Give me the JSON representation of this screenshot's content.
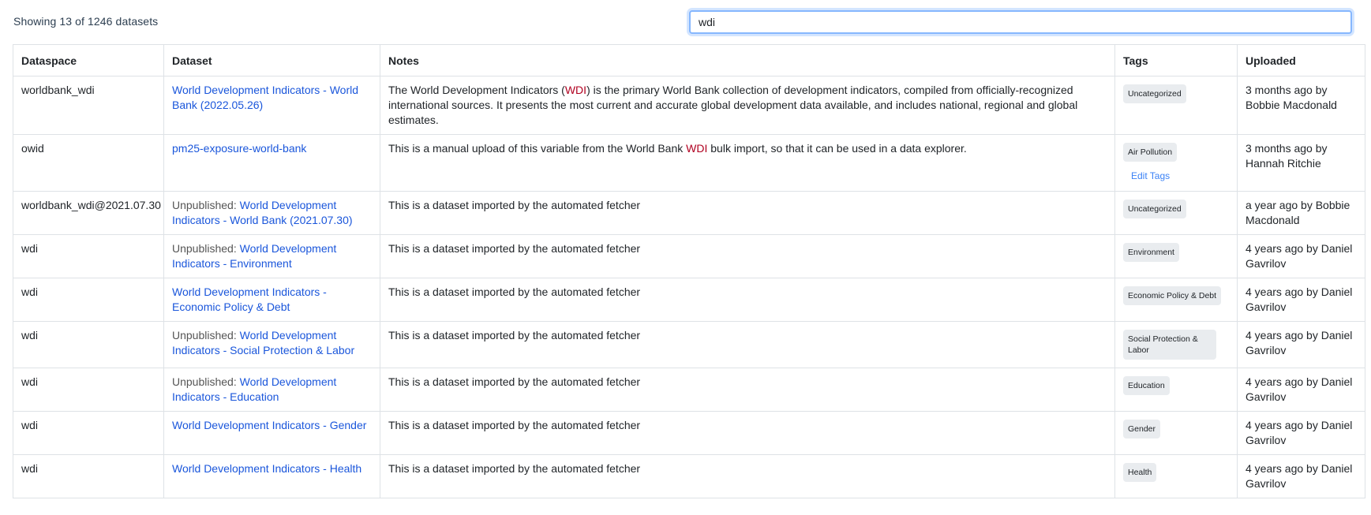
{
  "header": {
    "count_text": "Showing 13 of 1246 datasets",
    "search_value": "wdi"
  },
  "table": {
    "columns": [
      "Dataspace",
      "Dataset",
      "Notes",
      "Tags",
      "Uploaded"
    ],
    "rows": [
      {
        "dataspace": "worldbank_wdi",
        "unpublished": "",
        "dataset": "World Development Indicators - World Bank (2022.05.26)",
        "notes_parts": [
          "The World Development Indicators (",
          "WDI",
          ") is the primary World Bank collection of development indicators, compiled from officially-recognized international sources. It presents the most current and accurate global development data available, and includes national, regional and global estimates."
        ],
        "tag": "Uncategorized",
        "uploaded": "3 months ago by Bobbie Macdonald"
      },
      {
        "dataspace": "owid",
        "unpublished": "",
        "dataset": "pm25-exposure-world-bank",
        "notes_parts": [
          "This is a manual upload of this variable from the World Bank ",
          "WDI",
          " bulk import, so that it can be used in a data explorer."
        ],
        "tag": "Air Pollution",
        "edit_tags": "Edit Tags",
        "uploaded": "3 months ago by Hannah Ritchie"
      },
      {
        "dataspace": "worldbank_wdi@2021.07.30",
        "unpublished": "Unpublished: ",
        "dataset": "World Development Indicators - World Bank (2021.07.30)",
        "notes_parts": [
          "This is a dataset imported by the automated fetcher"
        ],
        "tag": "Uncategorized",
        "uploaded": "a year ago by Bobbie Macdonald"
      },
      {
        "dataspace": "wdi",
        "unpublished": "Unpublished: ",
        "dataset": "World Development Indicators - Environment",
        "notes_parts": [
          "This is a dataset imported by the automated fetcher"
        ],
        "tag": "Environment",
        "uploaded": "4 years ago by Daniel Gavrilov"
      },
      {
        "dataspace": "wdi",
        "unpublished": "",
        "dataset": "World Development Indicators - Economic Policy & Debt",
        "notes_parts": [
          "This is a dataset imported by the automated fetcher"
        ],
        "tag": "Economic Policy & Debt",
        "uploaded": "4 years ago by Daniel Gavrilov"
      },
      {
        "dataspace": "wdi",
        "unpublished": "Unpublished: ",
        "dataset": "World Development Indicators - Social Protection & Labor",
        "notes_parts": [
          "This is a dataset imported by the automated fetcher"
        ],
        "tag": "Social Protection & Labor",
        "uploaded": "4 years ago by Daniel Gavrilov"
      },
      {
        "dataspace": "wdi",
        "unpublished": "Unpublished: ",
        "dataset": "World Development Indicators - Education",
        "notes_parts": [
          "This is a dataset imported by the automated fetcher"
        ],
        "tag": "Education",
        "uploaded": "4 years ago by Daniel Gavrilov"
      },
      {
        "dataspace": "wdi",
        "unpublished": "",
        "dataset": "World Development Indicators - Gender",
        "notes_parts": [
          "This is a dataset imported by the automated fetcher"
        ],
        "tag": "Gender",
        "uploaded": "4 years ago by Daniel Gavrilov"
      },
      {
        "dataspace": "wdi",
        "unpublished": "",
        "dataset": "World Development Indicators - Health",
        "notes_parts": [
          "This is a dataset imported by the automated fetcher"
        ],
        "tag": "Health",
        "uploaded": "4 years ago by Daniel Gavrilov"
      }
    ]
  },
  "colors": {
    "link": "#1a56db",
    "highlight": "#b00020",
    "tag_bg": "#e9ecef",
    "border": "#dee2e6"
  }
}
